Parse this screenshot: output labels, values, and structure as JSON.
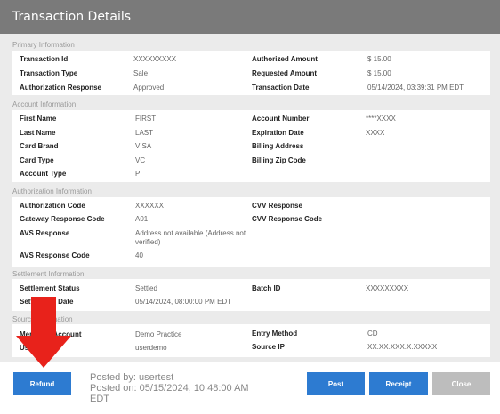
{
  "window": {
    "title": "Transaction Details"
  },
  "sections": {
    "primary": {
      "title": "Primary Information",
      "transaction_id": {
        "label": "Transaction Id",
        "value": "XXXXXXXXX"
      },
      "transaction_type": {
        "label": "Transaction Type",
        "value": "Sale"
      },
      "authorization_response": {
        "label": "Authorization Response",
        "value": "Approved"
      },
      "authorized_amount": {
        "label": "Authorized Amount",
        "value": "$ 15.00"
      },
      "requested_amount": {
        "label": "Requested Amount",
        "value": "$ 15.00"
      },
      "transaction_date": {
        "label": "Transaction Date",
        "value": "05/14/2024, 03:39:31 PM EDT"
      }
    },
    "account": {
      "title": "Account Information",
      "first_name": {
        "label": "First Name",
        "value": "FIRST"
      },
      "last_name": {
        "label": "Last Name",
        "value": "LAST"
      },
      "card_brand": {
        "label": "Card Brand",
        "value": "VISA"
      },
      "card_type": {
        "label": "Card Type",
        "value": "VC"
      },
      "account_type": {
        "label": "Account Type",
        "value": "P"
      },
      "account_number": {
        "label": "Account Number",
        "value": "****XXXX"
      },
      "expiration_date": {
        "label": "Expiration Date",
        "value": "XXXX"
      },
      "billing_address": {
        "label": "Billing Address",
        "value": ""
      },
      "billing_zip": {
        "label": "Billing Zip Code",
        "value": ""
      }
    },
    "authorization": {
      "title": "Authorization Information",
      "authorization_code": {
        "label": "Authorization Code",
        "value": "XXXXXX"
      },
      "gateway_response_code": {
        "label": "Gateway Response Code",
        "value": "A01"
      },
      "avs_response": {
        "label": "AVS Response",
        "value": "Address not available (Address not verified)"
      },
      "avs_response_code": {
        "label": "AVS Response Code",
        "value": "40"
      },
      "cvv_response": {
        "label": "CVV Response",
        "value": ""
      },
      "cvv_response_code": {
        "label": "CVV Response Code",
        "value": ""
      }
    },
    "settlement": {
      "title": "Settlement Information",
      "settlement_status": {
        "label": "Settlement Status",
        "value": "Settled"
      },
      "settlement_date": {
        "label": "Settlement Date",
        "value": "05/14/2024, 08:00:00 PM EDT"
      },
      "batch_id": {
        "label": "Batch ID",
        "value": "XXXXXXXXX"
      }
    },
    "source": {
      "title": "Source Information",
      "merchant_account": {
        "label": "Merchant Account",
        "value": "Demo Practice"
      },
      "user": {
        "label": "User",
        "value": "userdemo"
      },
      "entry_method": {
        "label": "Entry Method",
        "value": "CD"
      },
      "source_ip": {
        "label": "Source IP",
        "value": "XX.XX.XXX.X.XXXXX"
      }
    }
  },
  "footer": {
    "posted_by": "Posted by:  usertest",
    "posted_on": "Posted on: 05/15/2024, 10:48:00 AM EDT",
    "refund_label": "Refund",
    "post_label": "Post",
    "receipt_label": "Receipt",
    "close_label": "Close"
  },
  "colors": {
    "title_bar": "#7a7a7a",
    "content_bg": "#ebebeb",
    "primary_button": "#2d7bd1",
    "close_button": "#bdbdbd",
    "annotation_arrow": "#e8221b"
  },
  "icons": {
    "annotation": "red-down-arrow"
  }
}
